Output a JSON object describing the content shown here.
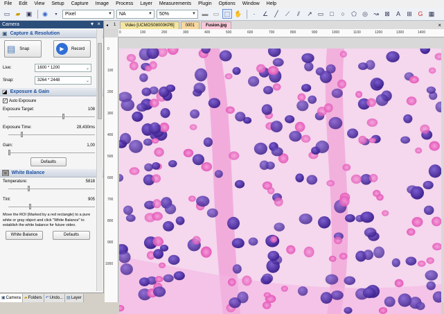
{
  "menu": [
    "File",
    "Edit",
    "View",
    "Setup",
    "Capture",
    "Image",
    "Process",
    "Layer",
    "Measurements",
    "Plugin",
    "Options",
    "Window",
    "Help"
  ],
  "toolbar": {
    "unit": "Pixel",
    "na": "NA",
    "zoom": "50%"
  },
  "panel": {
    "title": "Camera",
    "capture": {
      "title": "Capture & Resolution",
      "snap": "Snap",
      "record": "Record",
      "live_label": "Live:",
      "live_value": "1600 * 1200",
      "snap_label": "Snap:",
      "snap_value": "3264 * 2448"
    },
    "exposure": {
      "title": "Exposure & Gain",
      "auto": "Auto Exposure",
      "target_label": "Exposure Target:",
      "target_value": "108",
      "time_label": "Exposure Time:",
      "time_value": "28,430ms",
      "gain_label": "Gain:",
      "gain_value": "1,00",
      "defaults": "Defaults"
    },
    "wb": {
      "title": "White Balance",
      "temp_label": "Temperature:",
      "temp_value": "5818",
      "tint_label": "Tint:",
      "tint_value": "905",
      "hint": "Move the ROI (Marked by a red rectangle) to a pure white or gray object and click \"White Balance\" to establish the white balance for future video.",
      "wb_button": "White Balance",
      "defaults": "Defaults"
    }
  },
  "bottom_tabs": [
    "Camera",
    "Folders",
    "Undo...",
    "Layer"
  ],
  "doc_tabs": [
    "Video [UCMOS08000KPB]",
    "0001",
    "Fusion.jpg"
  ],
  "ruler_h": [
    "0",
    "100",
    "200",
    "300",
    "400",
    "500",
    "600",
    "700",
    "800",
    "900",
    "1000",
    "1100",
    "1200",
    "1300",
    "1400"
  ],
  "ruler_v": [
    "0",
    "100",
    "200",
    "300",
    "400",
    "500",
    "600",
    "700",
    "800",
    "900",
    "1000"
  ],
  "tab_number": "1"
}
